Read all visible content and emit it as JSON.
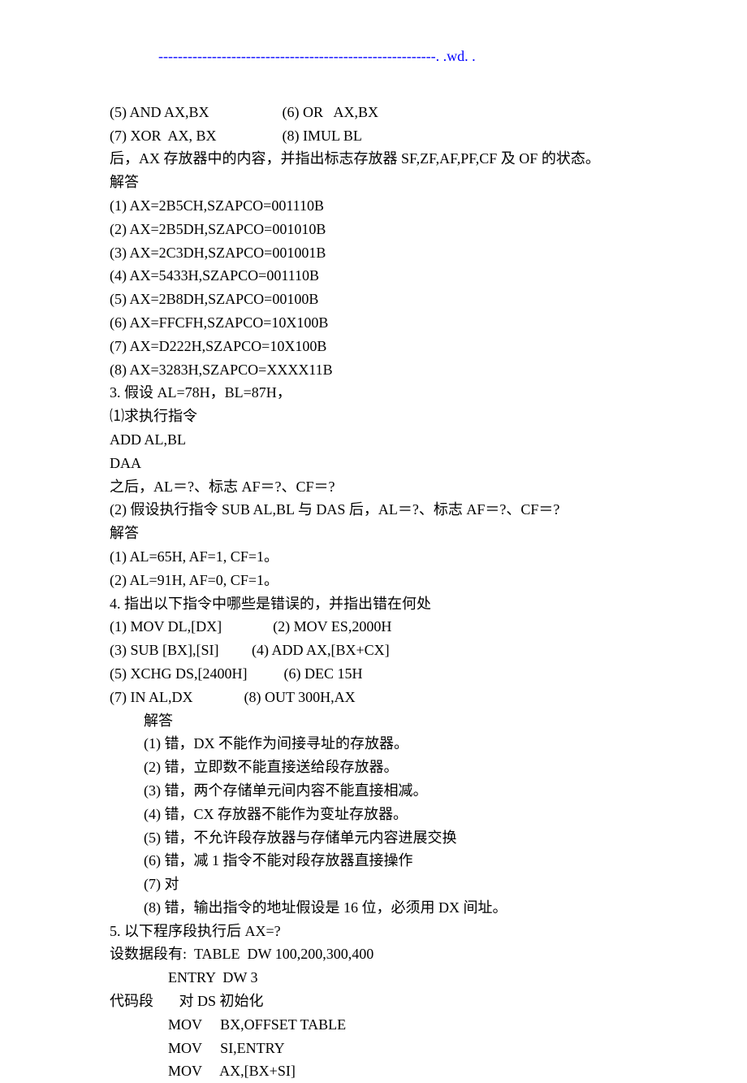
{
  "header": "---------------------------------------------------------. .wd. .",
  "lines": {
    "l1": "(5) AND AX,BX                    (6) OR   AX,BX",
    "l2": "(7) XOR  AX, BX                  (8) IMUL BL",
    "l3": "后，AX 存放器中的内容，并指出标志存放器 SF,ZF,AF,PF,CF 及 OF 的状态。",
    "l4": "解答",
    "l5": "(1) AX=2B5CH,SZAPCO=001110B",
    "l6": "(2) AX=2B5DH,SZAPCO=001010B",
    "l7": "(3) AX=2C3DH,SZAPCO=001001B",
    "l8": "(4) AX=5433H,SZAPCO=001110B",
    "l9": "(5) AX=2B8DH,SZAPCO=00100B",
    "l10": "(6) AX=FFCFH,SZAPCO=10X100B",
    "l11": "(7) AX=D222H,SZAPCO=10X100B",
    "l12": "(8) AX=3283H,SZAPCO=XXXX11B",
    "l13": "3. 假设 AL=78H，BL=87H，",
    "l14": "⑴求执行指令",
    "l15": "ADD AL,BL",
    "l16": "DAA",
    "l17": "之后，AL＝?、标志 AF＝?、CF＝?",
    "l18": "(2) 假设执行指令 SUB AL,BL 与 DAS 后，AL＝?、标志 AF＝?、CF＝?",
    "l19": "解答",
    "l20": "(1) AL=65H, AF=1, CF=1。",
    "l21": "(2) AL=91H, AF=0, CF=1。",
    "l22": "4. 指出以下指令中哪些是错误的，并指出错在何处",
    "l23": "(1) MOV DL,[DX]              (2) MOV ES,2000H",
    "l24": "(3) SUB [BX],[SI]         (4) ADD AX,[BX+CX]",
    "l25": "(5) XCHG DS,[2400H]          (6) DEC 15H",
    "l26": "(7) IN AL,DX              (8) OUT 300H,AX",
    "l27": "解答",
    "l28": "(1) 错，DX 不能作为间接寻址的存放器。",
    "l29": "(2) 错，立即数不能直接送给段存放器。",
    "l30": "(3) 错，两个存储单元间内容不能直接相减。",
    "l31": "(4) 错，CX 存放器不能作为变址存放器。",
    "l32": "(5) 错，不允许段存放器与存储单元内容进展交换",
    "l33": "(6) 错，减 1 指令不能对段存放器直接操作",
    "l34": "(7) 对",
    "l35": "(8) 错，输出指令的地址假设是 16 位，必须用 DX 间址。",
    "l36": "5. 以下程序段执行后 AX=?",
    "l37": "设数据段有:  TABLE  DW 100,200,300,400",
    "l38": "ENTRY  DW 3",
    "l39": "代码段       对 DS 初始化",
    "l40": "MOV     BX,OFFSET TABLE",
    "l41": "MOV     SI,ENTRY",
    "l42": "MOV     AX,[BX+SI]"
  }
}
